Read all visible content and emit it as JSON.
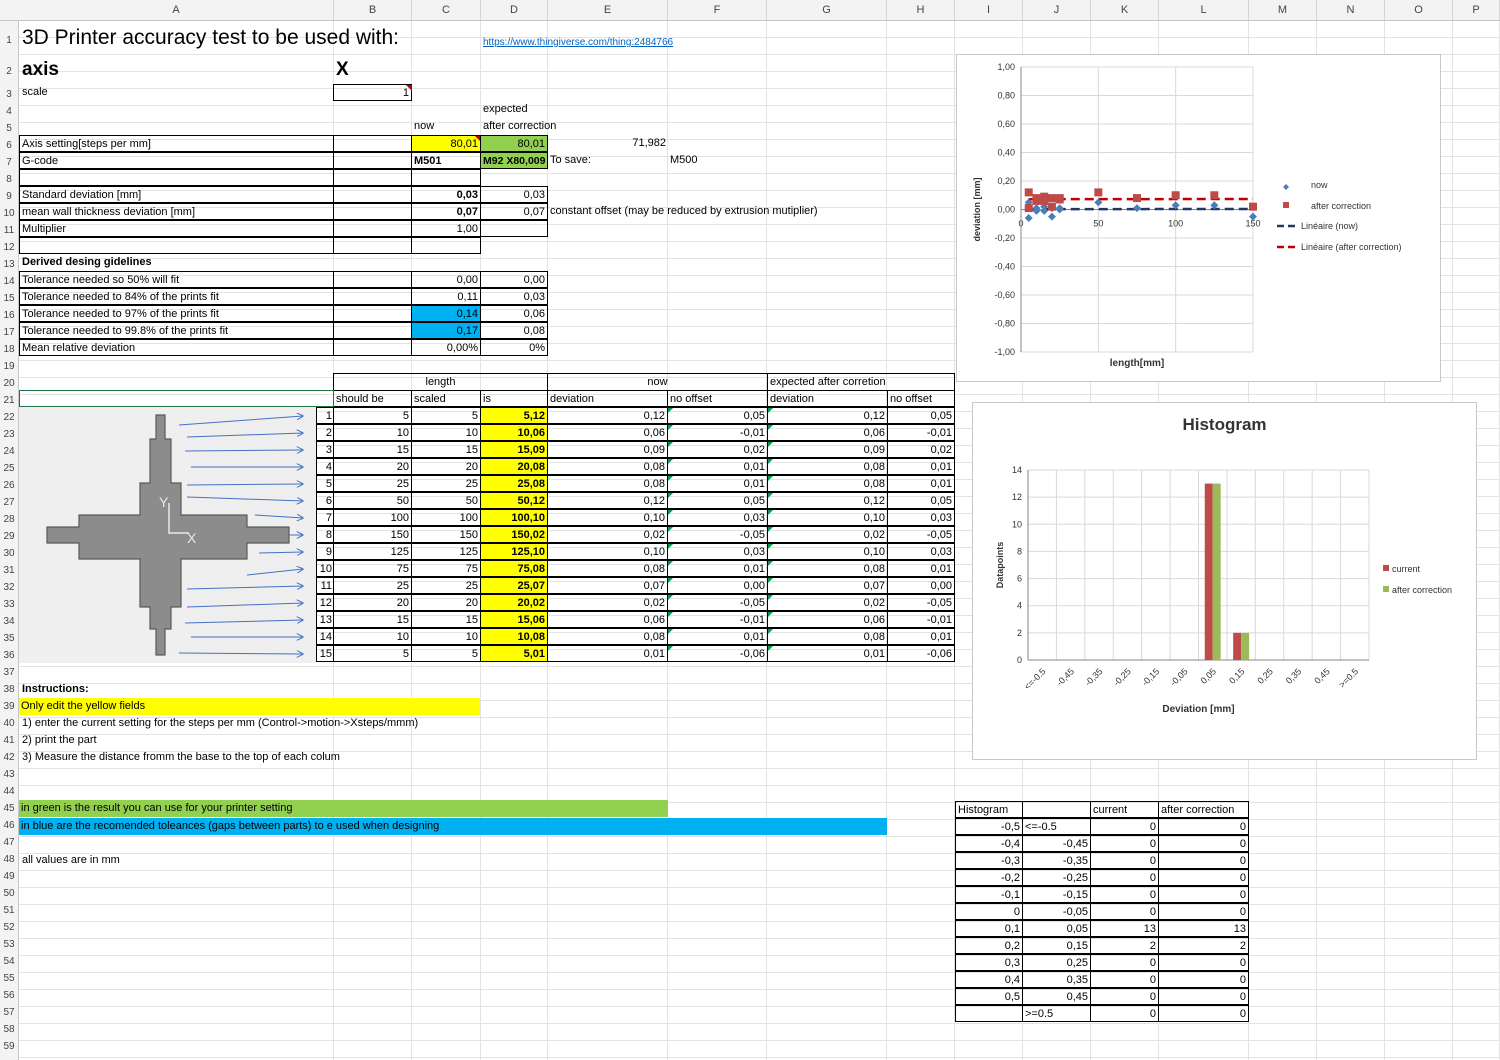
{
  "columns": [
    "A",
    "B",
    "C",
    "D",
    "E",
    "F",
    "G",
    "H",
    "I",
    "J",
    "K",
    "L",
    "M",
    "N",
    "O",
    "P"
  ],
  "rows": [
    "1",
    "2",
    "3",
    "4",
    "5",
    "6",
    "7",
    "8",
    "9",
    "10",
    "11",
    "12",
    "13",
    "14",
    "15",
    "16",
    "17",
    "18",
    "19",
    "20",
    "21",
    "22",
    "23",
    "24",
    "25",
    "26",
    "27",
    "28",
    "29",
    "30",
    "31",
    "32",
    "33",
    "34",
    "35",
    "36",
    "37",
    "38",
    "39",
    "40",
    "41",
    "42",
    "43",
    "44",
    "45",
    "46",
    "47",
    "48",
    "49",
    "50",
    "51",
    "52",
    "53",
    "54",
    "55",
    "56",
    "57",
    "58",
    "59"
  ],
  "header": {
    "title": "3D Printer accuracy test to be used with:",
    "link": "https://www.thingiverse.com/thing:2484766",
    "axis_label": "axis",
    "axis_value": "X",
    "scale_label": "scale",
    "scale_value": "1",
    "expected": "expected",
    "now": "now",
    "after_correction": "after correction"
  },
  "settings": {
    "axis_setting_label": "Axis setting[steps per mm]",
    "axis_now": "80,01",
    "axis_after": "80,01",
    "axis_extra": "71,982",
    "gcode_label": "G-code",
    "gcode_now": "M501",
    "gcode_after": "M92 X80,009",
    "to_save": "To save:",
    "to_save_value": "M500"
  },
  "stats": {
    "std_label": "Standard deviation [mm]",
    "std_now": "0,03",
    "std_after": "0,03",
    "mean_label": "mean wall thickness deviation [mm]",
    "mean_now": "0,07",
    "mean_after": "0,07",
    "mean_note": "constant offset (may be reduced by extrusion mutiplier)",
    "mult_label": "Multiplier",
    "mult_now": "1,00"
  },
  "guidelines": {
    "title": "Derived desing gidelines",
    "rows": [
      {
        "label": "Tolerance needed so 50% will fit",
        "now": "0,00",
        "after": "0,00"
      },
      {
        "label": "Tolerance needed to 84% of the prints fit",
        "now": "0,11",
        "after": "0,03"
      },
      {
        "label": "Tolerance needed to 97% of the prints fit",
        "now": "0,14",
        "after": "0,06"
      },
      {
        "label": "Tolerance needed to 99.8% of the prints fit",
        "now": "0,17",
        "after": "0,08"
      },
      {
        "label": "Mean relative deviation",
        "now": "0,00%",
        "after": "0%"
      }
    ]
  },
  "measure": {
    "h_length": "length",
    "h_now": "now",
    "h_expected": "expected after corretion",
    "h_should": "should be",
    "h_scaled": "scaled",
    "h_is": "is",
    "h_dev": "deviation",
    "h_nooff": "no offset",
    "h_dev2": "deviation",
    "h_nooff2": "no offset",
    "rows": [
      [
        "1",
        "5",
        "5",
        "5,12",
        "0,12",
        "0,05",
        "0,12",
        "0,05"
      ],
      [
        "2",
        "10",
        "10",
        "10,06",
        "0,06",
        "-0,01",
        "0,06",
        "-0,01"
      ],
      [
        "3",
        "15",
        "15",
        "15,09",
        "0,09",
        "0,02",
        "0,09",
        "0,02"
      ],
      [
        "4",
        "20",
        "20",
        "20,08",
        "0,08",
        "0,01",
        "0,08",
        "0,01"
      ],
      [
        "5",
        "25",
        "25",
        "25,08",
        "0,08",
        "0,01",
        "0,08",
        "0,01"
      ],
      [
        "6",
        "50",
        "50",
        "50,12",
        "0,12",
        "0,05",
        "0,12",
        "0,05"
      ],
      [
        "7",
        "100",
        "100",
        "100,10",
        "0,10",
        "0,03",
        "0,10",
        "0,03"
      ],
      [
        "8",
        "150",
        "150",
        "150,02",
        "0,02",
        "-0,05",
        "0,02",
        "-0,05"
      ],
      [
        "9",
        "125",
        "125",
        "125,10",
        "0,10",
        "0,03",
        "0,10",
        "0,03"
      ],
      [
        "10",
        "75",
        "75",
        "75,08",
        "0,08",
        "0,01",
        "0,08",
        "0,01"
      ],
      [
        "11",
        "25",
        "25",
        "25,07",
        "0,07",
        "0,00",
        "0,07",
        "0,00"
      ],
      [
        "12",
        "20",
        "20",
        "20,02",
        "0,02",
        "-0,05",
        "0,02",
        "-0,05"
      ],
      [
        "13",
        "15",
        "15",
        "15,06",
        "0,06",
        "-0,01",
        "0,06",
        "-0,01"
      ],
      [
        "14",
        "10",
        "10",
        "10,08",
        "0,08",
        "0,01",
        "0,08",
        "0,01"
      ],
      [
        "15",
        "5",
        "5",
        "5,01",
        "0,01",
        "-0,06",
        "0,01",
        "-0,06"
      ]
    ]
  },
  "part_image": {
    "label_y": "Y",
    "label_x": "X"
  },
  "instructions": {
    "title": "Instructions:",
    "yellow": "Only edit the yellow fields",
    "step1": "1) enter the current setting for the steps per mm (Control->motion->Xsteps/mmm)",
    "step2": "2) print the  part",
    "step3": "3) Measure the distance fromm the base to the top of each colum",
    "green": "in green is the result you can use for your printer setting",
    "blue": "in blue are the recomended toleances (gaps between parts) to e used when designing",
    "mm": "all values are in mm"
  },
  "histogram_table": {
    "h_title": "Histogram",
    "h_current": "current",
    "h_after": "after correction",
    "rows": [
      [
        "-0,5",
        "<=-0.5",
        "0",
        "0"
      ],
      [
        "-0,4",
        "-0,45",
        "0",
        "0"
      ],
      [
        "-0,3",
        "-0,35",
        "0",
        "0"
      ],
      [
        "-0,2",
        "-0,25",
        "0",
        "0"
      ],
      [
        "-0,1",
        "-0,15",
        "0",
        "0"
      ],
      [
        "0",
        "-0,05",
        "0",
        "0"
      ],
      [
        "0,1",
        "0,05",
        "13",
        "13"
      ],
      [
        "0,2",
        "0,15",
        "2",
        "2"
      ],
      [
        "0,3",
        "0,25",
        "0",
        "0"
      ],
      [
        "0,4",
        "0,35",
        "0",
        "0"
      ],
      [
        "0,5",
        "0,45",
        "0",
        "0"
      ],
      [
        "",
        ">=0.5",
        "0",
        "0"
      ]
    ]
  },
  "chart_data": [
    {
      "type": "scatter",
      "title": "",
      "xlabel": "length[mm]",
      "ylabel": "deviation [mm]",
      "xlim": [
        0,
        150
      ],
      "ylim": [
        -1,
        1
      ],
      "xticks": [
        "0",
        "50",
        "100",
        "150"
      ],
      "yticks": [
        "1,00",
        "0,80",
        "0,60",
        "0,40",
        "0,20",
        "0,00",
        "-0,20",
        "-0,40",
        "-0,60",
        "-0,80",
        "-1,00"
      ],
      "legend_position": "right",
      "series": [
        {
          "name": "now",
          "color": "#4a7ebb",
          "x": [
            5,
            10,
            15,
            20,
            25,
            50,
            100,
            150,
            125,
            75,
            25,
            20,
            15,
            10,
            5
          ],
          "y": [
            0.05,
            -0.01,
            0.02,
            0.01,
            0.01,
            0.05,
            0.03,
            -0.05,
            0.03,
            0.01,
            0.0,
            -0.05,
            -0.01,
            0.01,
            -0.06
          ]
        },
        {
          "name": "after correction",
          "color": "#be4b48",
          "x": [
            5,
            10,
            15,
            20,
            25,
            50,
            100,
            150,
            125,
            75,
            25,
            20,
            15,
            10,
            5
          ],
          "y": [
            0.12,
            0.06,
            0.09,
            0.08,
            0.08,
            0.12,
            0.1,
            0.02,
            0.1,
            0.08,
            0.07,
            0.02,
            0.06,
            0.08,
            0.01
          ]
        },
        {
          "name": "Linéaire (now)",
          "color": "#1f3864",
          "trend": true
        },
        {
          "name": "Linéaire (after correction)",
          "color": "#c00000",
          "trend": true
        }
      ]
    },
    {
      "type": "bar",
      "title": "Histogram",
      "xlabel": "Deviation [mm]",
      "ylabel": "Datapoints",
      "ylim": [
        0,
        14
      ],
      "yticks": [
        "0",
        "2",
        "4",
        "6",
        "8",
        "10",
        "12",
        "14"
      ],
      "categories": [
        "<=-0.5",
        "-0,45",
        "-0,35",
        "-0,25",
        "-0,15",
        "-0,05",
        "0,05",
        "0,15",
        "0,25",
        "0,35",
        "0,45",
        ">=0.5"
      ],
      "legend_position": "right",
      "series": [
        {
          "name": "current",
          "color": "#be4b48",
          "values": [
            0,
            0,
            0,
            0,
            0,
            0,
            13,
            2,
            0,
            0,
            0,
            0
          ]
        },
        {
          "name": "after correction",
          "color": "#9bbb59",
          "values": [
            0,
            0,
            0,
            0,
            0,
            0,
            13,
            2,
            0,
            0,
            0,
            0
          ]
        }
      ]
    }
  ]
}
